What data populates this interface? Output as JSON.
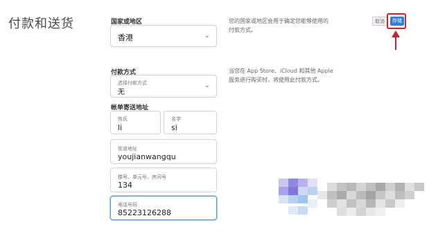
{
  "page": {
    "section_title": "付款和送货"
  },
  "actions": {
    "cancel_label": "取消",
    "save_label": "存储"
  },
  "country": {
    "label": "国家或地区",
    "value": "香港",
    "hint_line1": "您的国家或地区会用于确定您能够使用的",
    "hint_line2": "付款方式。"
  },
  "payment": {
    "label": "付款方式",
    "caption": "选择付款方式",
    "value": "无",
    "hint_line1": "当您在 App Store、iCloud 和其他 Apple",
    "hint_line2": "服务进行购买时，将使用此付款方式。"
  },
  "billing": {
    "label": "帐单寄送地址",
    "last_name_caption": "姓氏",
    "last_name_value": "li",
    "first_name_caption": "名字",
    "first_name_value": "si",
    "street_caption": "街道地址",
    "street_value": "youjianwangqu",
    "building_caption": "楼号、单元号、房间号",
    "building_value": "134",
    "phone_caption": "电话号码",
    "phone_value": "85223126288"
  },
  "colors": {
    "save_button": "#2f7fd8",
    "annotation_red": "#c8232c",
    "focus_border": "#5b9bd5"
  },
  "icons": [
    "chevron-down-icon",
    "up-arrow-annotation"
  ]
}
